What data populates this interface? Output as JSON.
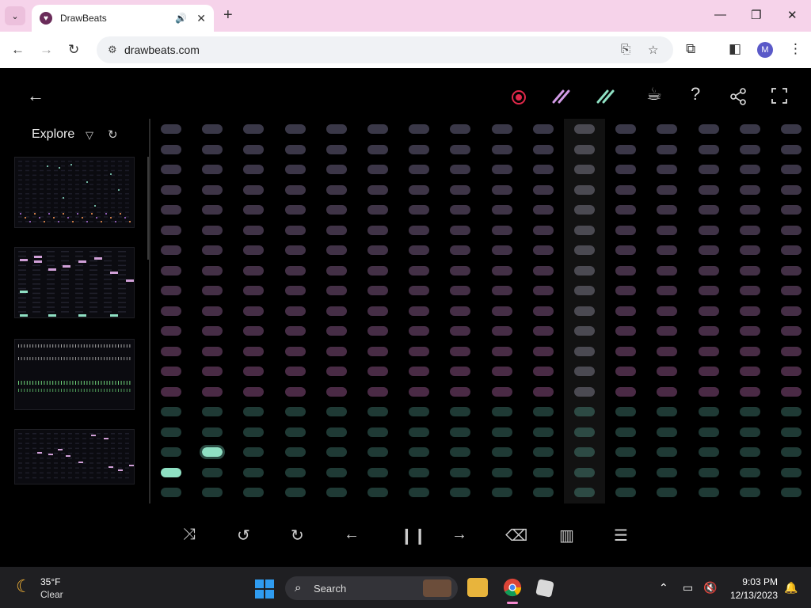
{
  "browser": {
    "tab_title": "DrawBeats",
    "tab_audio": "🔊",
    "tab_close": "✕",
    "new_tab": "+",
    "url": "drawbeats.com",
    "avatar_letter": "M",
    "minimize": "—",
    "restore": "❐",
    "close": "✕"
  },
  "app": {
    "explore_title": "Explore"
  },
  "grid": {
    "columns": 16,
    "rows": 19,
    "pink_rows": 14,
    "playhead_column": 10,
    "active_cells": [
      {
        "row": 16,
        "col": 1
      },
      {
        "row": 17,
        "col": 0
      }
    ],
    "colors": {
      "pink_top": "#3a3848",
      "pink_bottom": "#4a2a45",
      "green": "#1f3a35",
      "active": "#8fe0c3",
      "playhead_bg": "#121212"
    }
  },
  "taskbar": {
    "temp": "35°F",
    "condition": "Clear",
    "search_label": "Search",
    "time": "9:03 PM",
    "date": "12/13/2023"
  }
}
